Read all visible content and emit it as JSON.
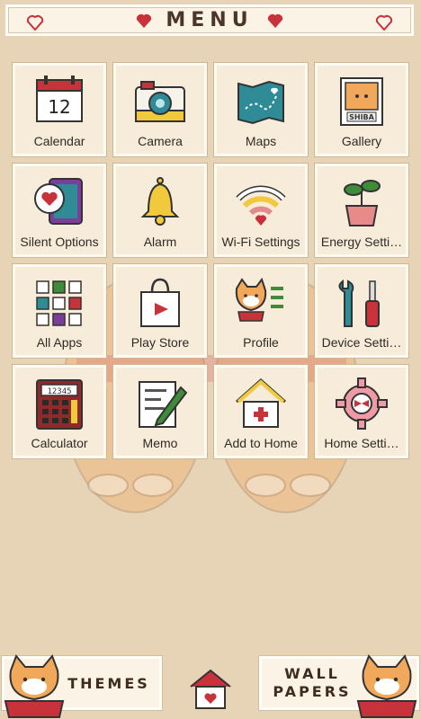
{
  "header": {
    "title": "MENU"
  },
  "tiles": [
    {
      "label": "Calendar",
      "icon": "calendar-icon"
    },
    {
      "label": "Camera",
      "icon": "camera-icon"
    },
    {
      "label": "Maps",
      "icon": "map-icon"
    },
    {
      "label": "Gallery",
      "icon": "gallery-icon"
    },
    {
      "label": "Silent Options",
      "icon": "tablet-heart-icon"
    },
    {
      "label": "Alarm",
      "icon": "bell-icon"
    },
    {
      "label": "Wi-Fi Settings",
      "icon": "wifi-icon"
    },
    {
      "label": "Energy Setti…",
      "icon": "plant-icon"
    },
    {
      "label": "All Apps",
      "icon": "apps-grid-icon"
    },
    {
      "label": "Play Store",
      "icon": "shopping-bag-icon"
    },
    {
      "label": "Profile",
      "icon": "shiba-profile-icon"
    },
    {
      "label": "Device Setti…",
      "icon": "tools-icon"
    },
    {
      "label": "Calculator",
      "icon": "calculator-icon"
    },
    {
      "label": "Memo",
      "icon": "memo-pencil-icon"
    },
    {
      "label": "Add to Home",
      "icon": "house-plus-icon"
    },
    {
      "label": "Home Setti…",
      "icon": "gear-bow-icon"
    }
  ],
  "calendar_day": "12",
  "gallery_caption": "SHIBA",
  "calculator_display": "12345",
  "footer": {
    "themes_label": "THEMES",
    "wall_line1": "WALL",
    "wall_line2": "PAPERS"
  },
  "colors": {
    "background": "#e7d3b6",
    "accent_red": "#c8323a",
    "teal": "#2f8b95",
    "yellow": "#f2c83c"
  }
}
